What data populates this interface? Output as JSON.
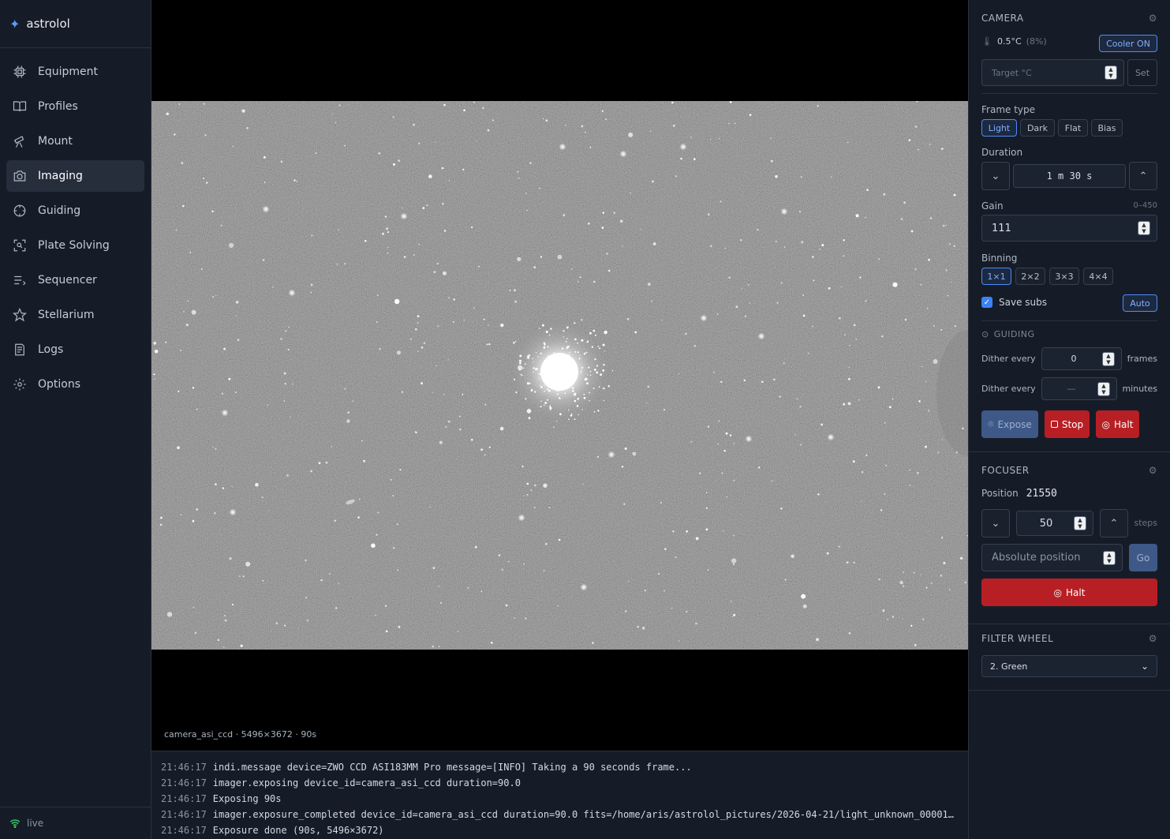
{
  "app": {
    "name": "astrolol",
    "status": "live"
  },
  "nav": [
    {
      "label": "Equipment",
      "icon": "chip-icon"
    },
    {
      "label": "Profiles",
      "icon": "book-icon"
    },
    {
      "label": "Mount",
      "icon": "telescope-icon"
    },
    {
      "label": "Imaging",
      "icon": "camera-icon",
      "active": true
    },
    {
      "label": "Guiding",
      "icon": "crosshair-icon"
    },
    {
      "label": "Plate Solving",
      "icon": "scan-icon"
    },
    {
      "label": "Sequencer",
      "icon": "list-icon"
    },
    {
      "label": "Stellarium",
      "icon": "star-icon"
    },
    {
      "label": "Logs",
      "icon": "logs-icon"
    },
    {
      "label": "Options",
      "icon": "gear-icon"
    }
  ],
  "viewer": {
    "caption": "camera_asi_ccd · 5496×3672 · 90s"
  },
  "log": [
    {
      "time": "21:46:17",
      "text": "indi.message device=ZWO CCD ASI183MM Pro message=[INFO] Taking a 90 seconds frame..."
    },
    {
      "time": "21:46:17",
      "text": "imager.exposing device_id=camera_asi_ccd duration=90.0"
    },
    {
      "time": "21:46:17",
      "text": "Exposing 90s"
    },
    {
      "time": "21:46:17",
      "text": "imager.exposure_completed device_id=camera_asi_ccd duration=90.0 fits=/home/aris/astrolol_pictures/2026-04-21/light_unknown_000014…"
    },
    {
      "time": "21:46:17",
      "text": "Exposure done (90s, 5496×3672)"
    }
  ],
  "camera": {
    "title": "CAMERA",
    "temperature": "0.5°C",
    "cooler_power": "(8%)",
    "cooler_button": "Cooler ON",
    "target_placeholder": "Target °C",
    "set_label": "Set",
    "frame_type_label": "Frame type",
    "frame_types": [
      "Light",
      "Dark",
      "Flat",
      "Bias"
    ],
    "frame_type_selected": "Light",
    "duration_label": "Duration",
    "duration_value": "1 m 30 s",
    "gain_label": "Gain",
    "gain_range": "0–450",
    "gain_value": "111",
    "binning_label": "Binning",
    "binning_options": [
      "1×1",
      "2×2",
      "3×3",
      "4×4"
    ],
    "binning_selected": "1×1",
    "save_subs_label": "Save subs",
    "save_subs_checked": true,
    "auto_label": "Auto"
  },
  "guiding": {
    "title": "GUIDING",
    "dither_frames_label": "Dither every",
    "dither_frames_value": "0",
    "dither_frames_unit": "frames",
    "dither_minutes_label": "Dither every",
    "dither_minutes_placeholder": "—",
    "dither_minutes_unit": "minutes",
    "expose_label": "Expose",
    "stop_label": "Stop",
    "halt_label": "Halt"
  },
  "focuser": {
    "title": "FOCUSER",
    "position_label": "Position",
    "position_value": "21550",
    "step_value": "50",
    "step_unit": "steps",
    "absolute_placeholder": "Absolute position",
    "go_label": "Go",
    "halt_label": "Halt"
  },
  "filter_wheel": {
    "title": "FILTER WHEEL",
    "selected": "2. Green"
  },
  "colors": {
    "accent": "#4a8cf7",
    "danger": "#b81f24",
    "bg": "#161c27"
  }
}
